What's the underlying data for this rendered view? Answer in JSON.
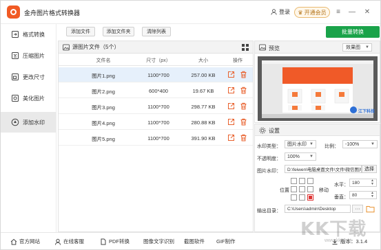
{
  "app": {
    "title": "金舟图片格式转换器",
    "login": "登录",
    "vip": "开通会员"
  },
  "colors": {
    "accent": "#1aa34a",
    "brand": "#f15a24",
    "selected_row": "#e6f0fb"
  },
  "sidebar": {
    "items": [
      {
        "label": "格式转换",
        "icon": "format-convert-icon"
      },
      {
        "label": "压缩图片",
        "icon": "compress-icon"
      },
      {
        "label": "更改尺寸",
        "icon": "resize-icon"
      },
      {
        "label": "美化图片",
        "icon": "beautify-icon"
      },
      {
        "label": "添加水印",
        "icon": "watermark-icon",
        "active": true
      }
    ]
  },
  "toolbar": {
    "add_file": "添加文件",
    "add_folder": "添加文件夹",
    "clear_list": "清除列表",
    "batch_convert": "批量转换"
  },
  "file_list": {
    "header": "源图片文件（5个）",
    "columns": [
      "文件名",
      "尺寸（px）",
      "大小",
      "操作"
    ],
    "rows": [
      {
        "name": "图片1.png",
        "size_px": "1100*700",
        "size": "257.00 KB"
      },
      {
        "name": "图片2.png",
        "size_px": "600*400",
        "size": "19.67 KB"
      },
      {
        "name": "图片3.png",
        "size_px": "1100*700",
        "size": "298.77 KB"
      },
      {
        "name": "图片4.png",
        "size_px": "1100*700",
        "size": "280.88 KB"
      },
      {
        "name": "图片5.png",
        "size_px": "1100*700",
        "size": "391.90 KB"
      }
    ]
  },
  "preview": {
    "title": "预览",
    "mode": "效果图",
    "watermark_text": "江下科技"
  },
  "settings": {
    "title": "设置",
    "watermark_type_label": "水印类型：",
    "watermark_type_value": "图片水印",
    "ratio_label": "比例：",
    "ratio_value": "-100%",
    "opacity_label": "不透明度：",
    "opacity_value": "100%",
    "image_watermark_label": "图片水印：",
    "image_watermark_path": "D:\\feiwen\\电脑桌面文件\\文件\\微信图片",
    "choose_button": "选择",
    "position_label": "位置",
    "move_label": "移动",
    "horizontal_label": "水平：",
    "horizontal_value": "180",
    "vertical_label": "垂直：",
    "vertical_value": "80",
    "output_label": "输出目录：",
    "output_path": "C:\\Users\\admin\\Desktop",
    "more_button": "···"
  },
  "bottom": {
    "official_site": "官方网站",
    "online_service": "在线客服",
    "pdf_convert": "PDF转换",
    "ocr": "图像文字识别",
    "screenshot": "截图软件",
    "gif": "GIF制作",
    "version": "版本：3.1.4"
  },
  "watermark_overlay": {
    "logo": "KK下载",
    "url": "www.kkx.net"
  }
}
